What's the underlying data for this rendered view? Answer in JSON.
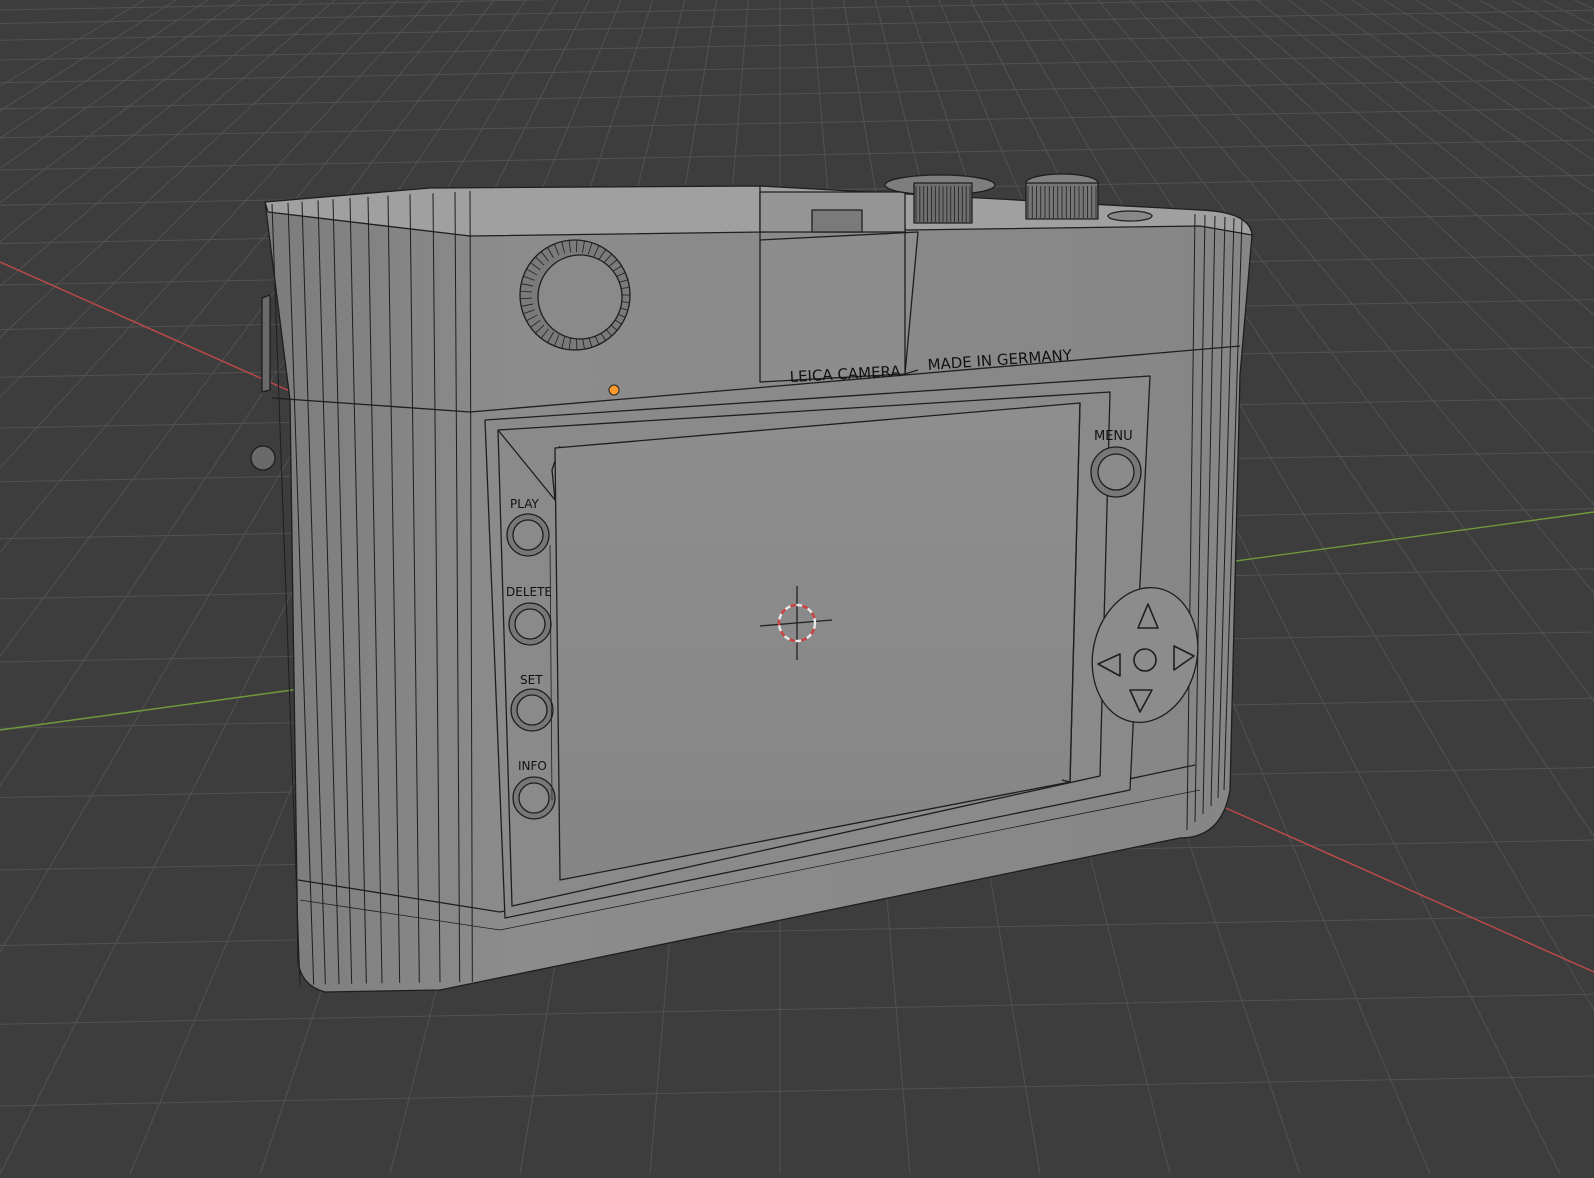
{
  "viewport": {
    "background": "#3d3d3d",
    "grid_color": "#525252",
    "x_axis_color": "#c04a4a",
    "y_axis_color": "#6f9a3c"
  },
  "model": {
    "body_color": "#8a8a8a",
    "top_color": "#9a9a9a",
    "wire_color": "#1e1e1e",
    "origin_dot_color": "#ff9a2e",
    "engravings": {
      "brand": "LEICA CAMERA",
      "origin": "MADE IN GERMANY"
    },
    "button_labels": {
      "play": "PLAY",
      "delete": "DELETE",
      "set": "SET",
      "info": "INFO",
      "menu": "MENU"
    },
    "dpad": {
      "up_icon": "triangle-up",
      "down_icon": "triangle-down",
      "left_icon": "triangle-left",
      "right_icon": "triangle-right",
      "center_icon": "circle"
    }
  },
  "cursor": {
    "icon": "3d-cursor-crosshair",
    "ring_colors": [
      "#e0e0e0",
      "#d04040"
    ]
  }
}
